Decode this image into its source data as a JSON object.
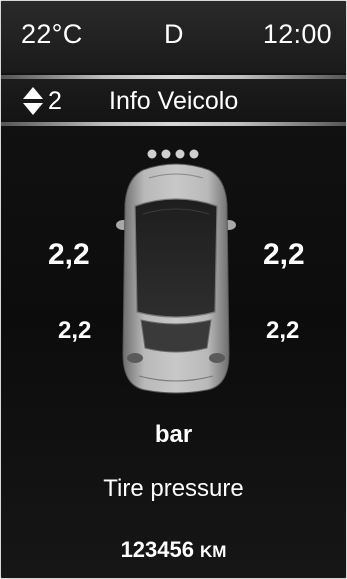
{
  "status": {
    "temperature": "22°C",
    "gear": "D",
    "clock": "12:00"
  },
  "menu": {
    "icon": "up-down-arrows-icon",
    "index": "2",
    "title": "Info Veicolo"
  },
  "tires": {
    "front_left": "2,2",
    "front_right": "2,2",
    "rear_left": "2,2",
    "rear_right": "2,2"
  },
  "unit": "bar",
  "caption": "Tire pressure",
  "odometer": {
    "value": "123456",
    "unit": "KM"
  },
  "colors": {
    "background": "#0c0c0c",
    "text": "#ffffff",
    "separator": "#d8d8d8",
    "car_body": "#9a9a9a"
  }
}
